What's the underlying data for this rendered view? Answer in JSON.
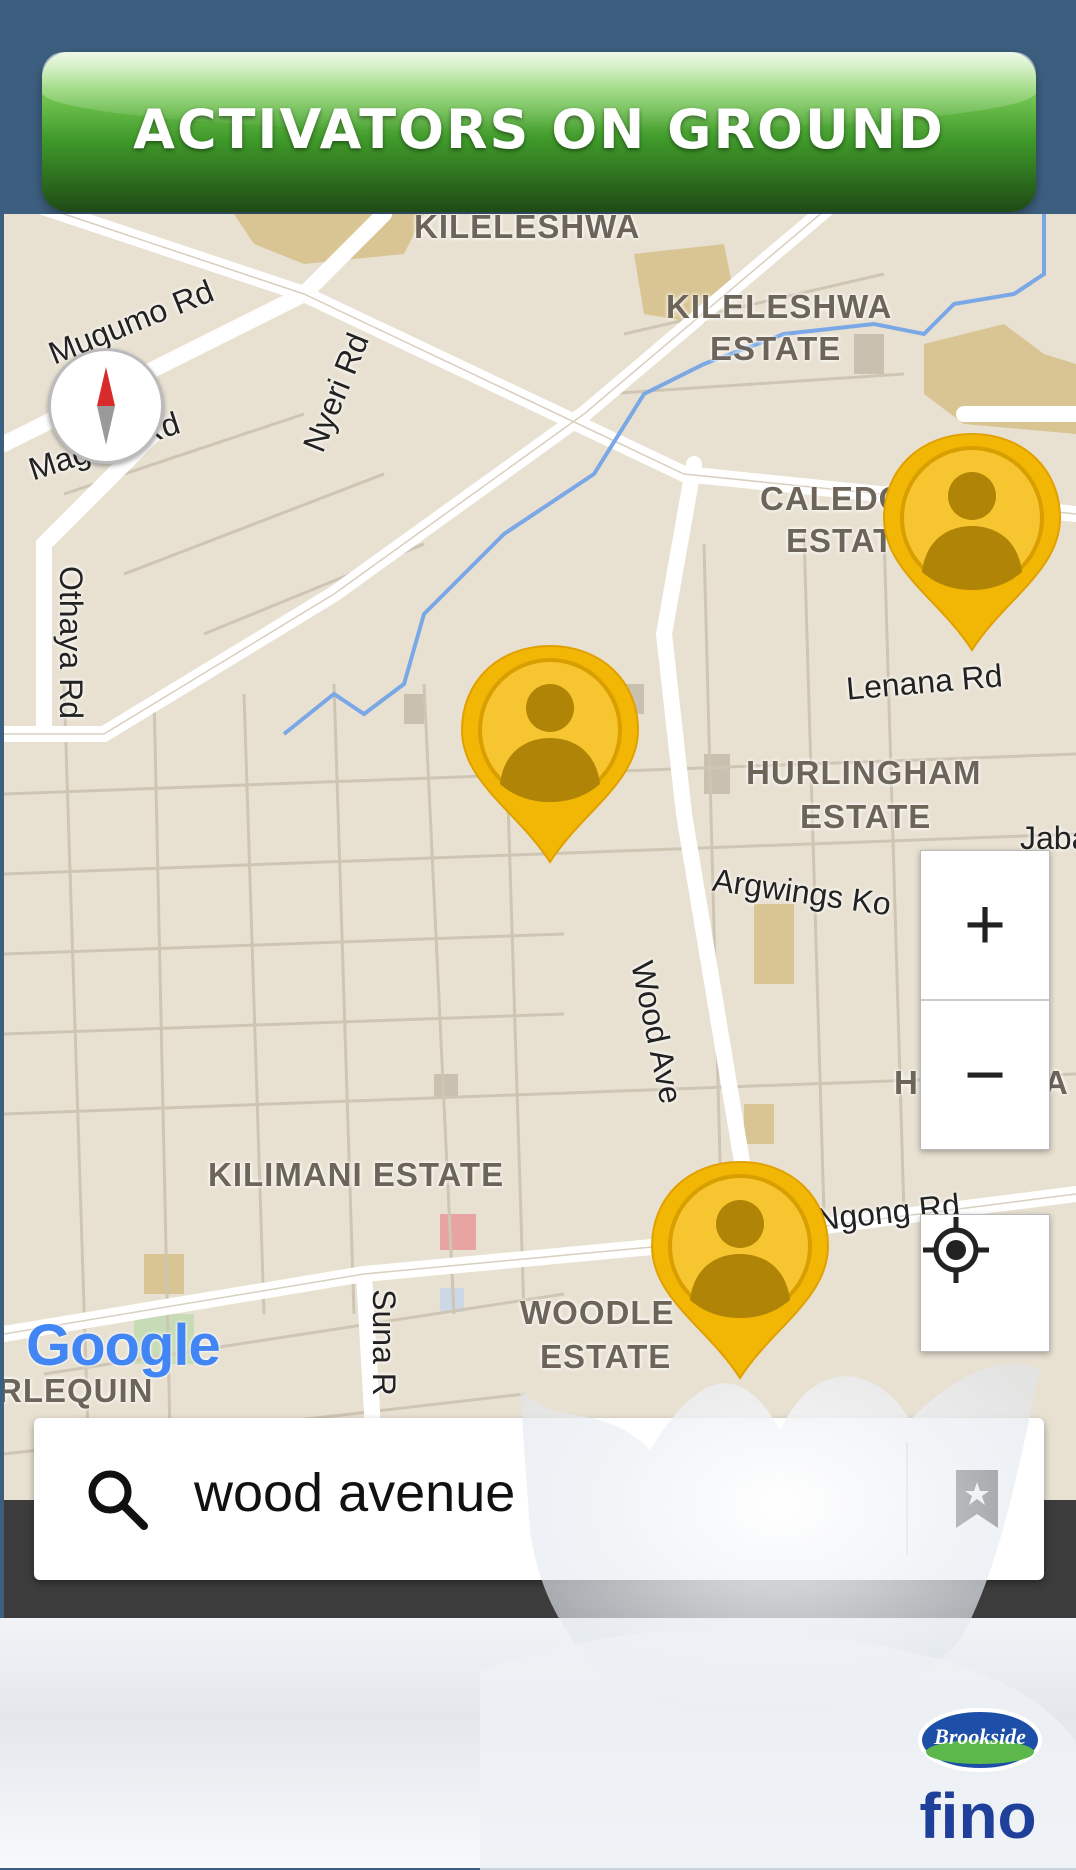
{
  "banner": {
    "title": "ACTIVATORS ON GROUND"
  },
  "map": {
    "areas": [
      {
        "name": "KILELESHWA"
      },
      {
        "name": "KILELESHWA"
      },
      {
        "name": "ESTATE"
      },
      {
        "name": "CALEDO"
      },
      {
        "name": "ESTATE"
      },
      {
        "name": "HURLINGHAM"
      },
      {
        "name": "ESTATE"
      },
      {
        "name": "KILIMANI ESTATE"
      },
      {
        "name": "WOODLE"
      },
      {
        "name": "ESTATE"
      },
      {
        "name": "RLEQUIN"
      },
      {
        "name": "H"
      },
      {
        "name": "A"
      }
    ],
    "roads": [
      {
        "name": "Mugumo Rd"
      },
      {
        "name": "Mageta Rd"
      },
      {
        "name": "Nyeri Rd"
      },
      {
        "name": "Othaya Rd"
      },
      {
        "name": "Lenana Rd"
      },
      {
        "name": "Argwings Ko"
      },
      {
        "name": "Wood Ave"
      },
      {
        "name": "Ngong Rd"
      },
      {
        "name": "Suna R"
      },
      {
        "name": "Jaba"
      }
    ],
    "attribution": "Google",
    "zoom_in_label": "+",
    "zoom_out_label": "−",
    "markers_count": 3
  },
  "search": {
    "query": "wood avenue"
  },
  "icons": {
    "search": "search-icon",
    "bookmark": "bookmark-star-icon",
    "locate": "my-location-icon",
    "compass": "compass-icon",
    "marker": "person-pin-icon"
  },
  "brand": {
    "top": "Brookside",
    "bottom": "fino"
  },
  "colors": {
    "frame": "#3d5f7f",
    "banner": "#3f9a2a",
    "marker": "#f2b705",
    "map": "#e8e1d2"
  }
}
